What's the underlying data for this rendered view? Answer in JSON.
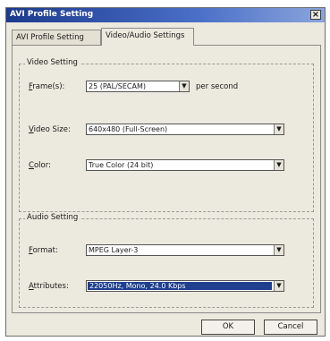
{
  "window": {
    "title": "AVI Profile Setting",
    "close_label": "×"
  },
  "tabs": [
    {
      "label": "AVI Profile Setting"
    },
    {
      "label": "Video/Audio Settings"
    }
  ],
  "video": {
    "group_title": "Video Setting",
    "frames": {
      "label_u": "F",
      "label_rest": "rame(s):",
      "value": "25 (PAL/SECAM)",
      "suffix": "per second"
    },
    "size": {
      "label_u": "V",
      "label_rest": "ideo Size:",
      "value": "640x480 (Full-Screen)"
    },
    "color": {
      "label_u": "C",
      "label_rest": "olor:",
      "value": "True Color (24 bit)"
    }
  },
  "audio": {
    "group_title": "Audio Setting",
    "format": {
      "label_u": "F",
      "label_rest": "ormat:",
      "value": "MPEG Layer-3"
    },
    "attributes": {
      "label_u": "A",
      "label_rest": "ttributes:",
      "value": "22050Hz, Mono, 24.0 Kbps"
    }
  },
  "buttons": {
    "ok": "OK",
    "cancel": "Cancel"
  },
  "icons": {
    "dropdown": "▼"
  }
}
